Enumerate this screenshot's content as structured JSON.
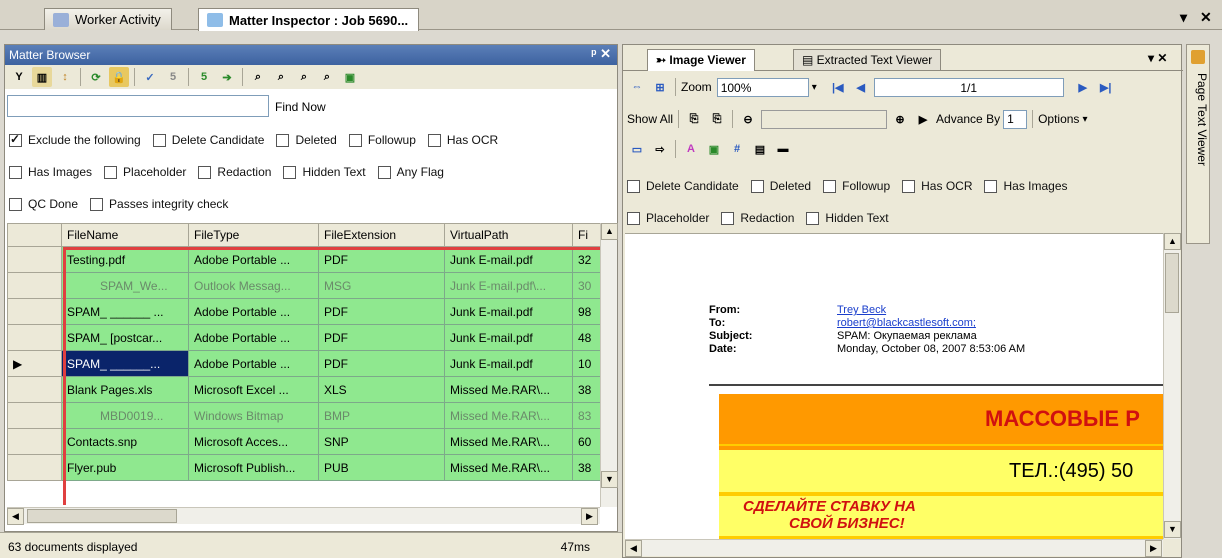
{
  "tabs": [
    {
      "label": "Worker Activity"
    },
    {
      "label": "Matter Inspector : Job 5690..."
    }
  ],
  "matter_browser": {
    "title": "Matter Browser",
    "search_value": "",
    "find_now": "Find Now",
    "filters_row1": [
      "Exclude the following",
      "Delete Candidate",
      "Deleted",
      "Followup",
      "Has OCR"
    ],
    "filters_row2": [
      "Has Images",
      "Placeholder",
      "Redaction",
      "Hidden Text",
      "Any Flag"
    ],
    "filters_row3": [
      "QC Done",
      "Passes integrity check"
    ],
    "columns": [
      "FileName",
      "FileType",
      "FileExtension",
      "VirtualPath",
      "Fi"
    ],
    "rows": [
      {
        "name": "Testing.pdf",
        "type": "Adobe Portable ...",
        "ext": "PDF",
        "path": "Junk E-mail.pdf",
        "fi": "32"
      },
      {
        "name": "SPAM_We...",
        "type": "Outlook Messag...",
        "ext": "MSG",
        "path": "Junk E-mail.pdf\\...",
        "fi": "30"
      },
      {
        "name": "SPAM_ ______ ...",
        "type": "Adobe Portable ...",
        "ext": "PDF",
        "path": "Junk E-mail.pdf",
        "fi": "98"
      },
      {
        "name": "SPAM_ [postcar...",
        "type": "Adobe Portable ...",
        "ext": "PDF",
        "path": "Junk E-mail.pdf",
        "fi": "48"
      },
      {
        "name": "SPAM_ ______...",
        "type": "Adobe Portable ...",
        "ext": "PDF",
        "path": "Junk E-mail.pdf",
        "fi": "10"
      },
      {
        "name": "Blank Pages.xls",
        "type": "Microsoft Excel ...",
        "ext": "XLS",
        "path": "Missed Me.RAR\\...",
        "fi": "38"
      },
      {
        "name": "MBD0019...",
        "type": "Windows Bitmap",
        "ext": "BMP",
        "path": "Missed Me.RAR\\...",
        "fi": "83"
      },
      {
        "name": "Contacts.snp",
        "type": "Microsoft Acces...",
        "ext": "SNP",
        "path": "Missed Me.RAR\\...",
        "fi": "60"
      },
      {
        "name": "Flyer.pub",
        "type": "Microsoft Publish...",
        "ext": "PUB",
        "path": "Missed Me.RAR\\...",
        "fi": "38"
      }
    ],
    "status": "63 documents displayed",
    "timing": "47ms"
  },
  "viewer": {
    "tabs": [
      "Image Viewer",
      "Extracted Text Viewer"
    ],
    "zoom_label": "Zoom",
    "zoom_value": "100%",
    "page": "1/1",
    "show_all": "Show All",
    "advance_by": "Advance By",
    "advance_value": "1",
    "options": "Options",
    "filters_row1": [
      "Delete Candidate",
      "Deleted",
      "Followup",
      "Has OCR",
      "Has Images"
    ],
    "filters_row2": [
      "Placeholder",
      "Redaction",
      "Hidden Text"
    ],
    "email": {
      "from_label": "From:",
      "from": "Trey Beck",
      "to_label": "To:",
      "to": "robert@blackcastlesoft.com;",
      "subject_label": "Subject:",
      "subject": "SPAM:  Окупаемая реклама",
      "date_label": "Date:",
      "date": "Monday, October 08, 2007 8:53:06 AM"
    },
    "banner1": "МАССОВЫЕ Р",
    "banner2": "ТЕЛ.:(495) 50",
    "banner3": "СДЕЛАЙТЕ СТАВКУ НА",
    "banner4": "СВОЙ БИЗНЕС!"
  },
  "side_tab": "Page Text Viewer",
  "colors": {
    "row_green": "#8fe88f",
    "selection_red": "#e04040",
    "header_blue": "#3d62a0"
  }
}
